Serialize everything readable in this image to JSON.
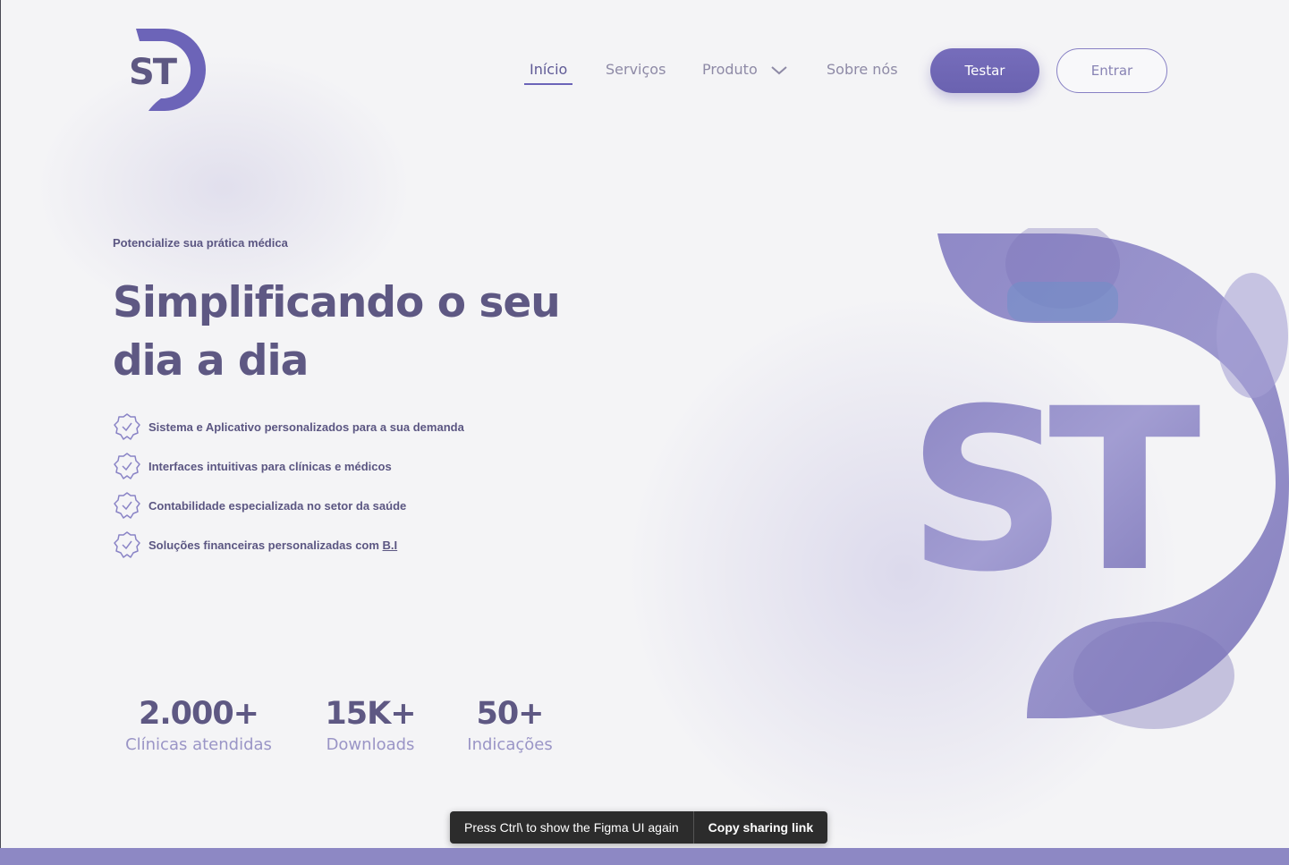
{
  "brand": {
    "logo_text": "ST",
    "accent": "#6c64b8",
    "text_color": "#5e5883"
  },
  "nav": {
    "items": [
      {
        "label": "Início",
        "active": true
      },
      {
        "label": "Serviços",
        "active": false
      },
      {
        "label": "Produto",
        "active": false,
        "has_dropdown": true
      },
      {
        "label": "Sobre nós",
        "active": false
      }
    ],
    "primary_button": "Testar",
    "secondary_button": "Entrar"
  },
  "hero": {
    "eyebrow": "Potencialize sua prática médica",
    "headline": "Simplificando o seu dia a dia",
    "features": [
      {
        "text": "Sistema e Aplicativo personalizados para a sua demanda"
      },
      {
        "text": "Interfaces intuitivas para clínicas e médicos"
      },
      {
        "text": "Contabilidade especializada no setor da saúde"
      },
      {
        "text": "Soluções financeiras personalizadas com ",
        "link": "B.I"
      }
    ],
    "graphic_text": "ST"
  },
  "stats": [
    {
      "value": "2.000+",
      "label": "Clínicas atendidas"
    },
    {
      "value": "15K+",
      "label": "Downloads"
    },
    {
      "value": "50+",
      "label": "Indicações"
    }
  ],
  "figma_toast": {
    "message": "Press Ctrl\\ to show the Figma UI again",
    "button": "Copy sharing link"
  }
}
